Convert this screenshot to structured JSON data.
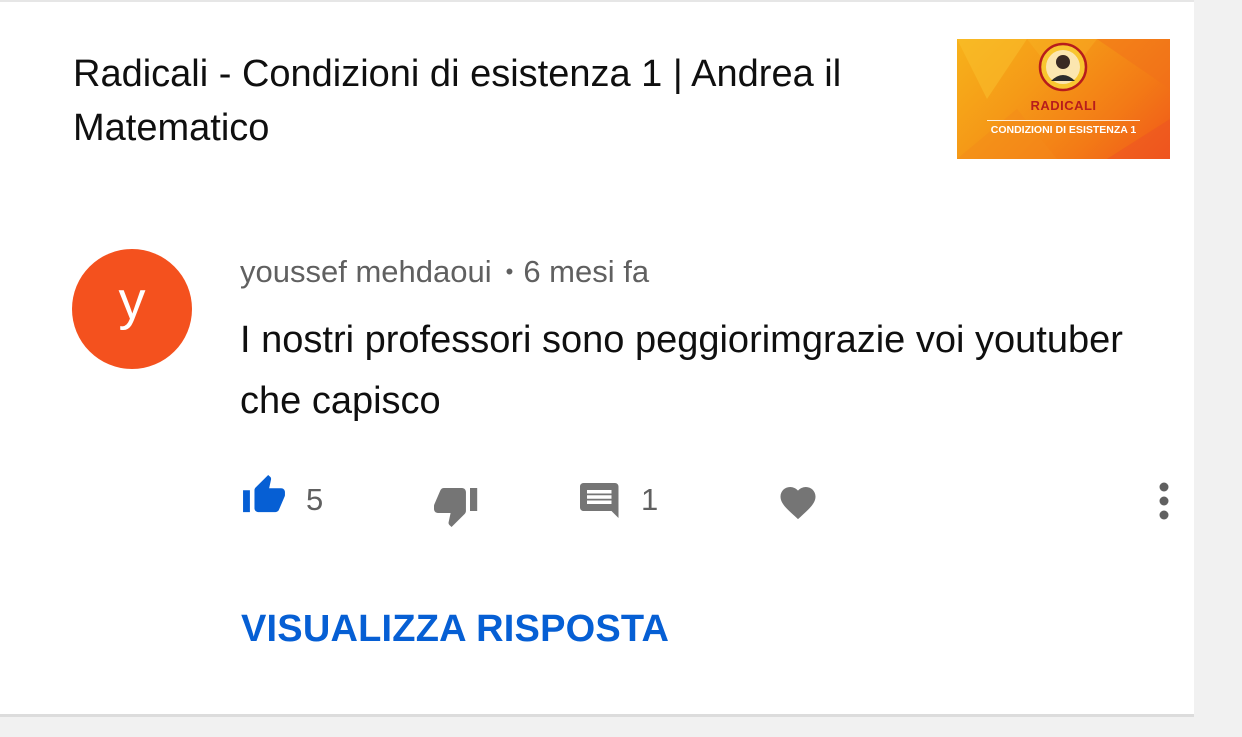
{
  "video": {
    "title": "Radicali - Condizioni di esistenza 1 | Andrea il Matematico",
    "thumbnail": {
      "title": "RADICALI",
      "subtitle": "CONDIZIONI DI ESISTENZA 1"
    }
  },
  "comment": {
    "avatar_letter": "y",
    "avatar_color": "#f4511e",
    "author": "youssef mehdaoui",
    "separator": "•",
    "time": "6 mesi fa",
    "text": "I nostri professori sono peggiorimgrazie voi youtuber che capisco",
    "like_count": "5",
    "reply_count": "1",
    "liked": true
  },
  "actions": {
    "like_icon": "thumb-up-icon",
    "dislike_icon": "thumb-down-icon",
    "reply_icon": "comment-icon",
    "heart_icon": "heart-icon",
    "more_icon": "more-vertical-icon",
    "view_reply_label": "VISUALIZZA RISPOSTA"
  },
  "colors": {
    "accent": "#065fd4",
    "icon_gray": "#757575",
    "text": "#0f0f0f",
    "secondary_text": "#606060"
  }
}
